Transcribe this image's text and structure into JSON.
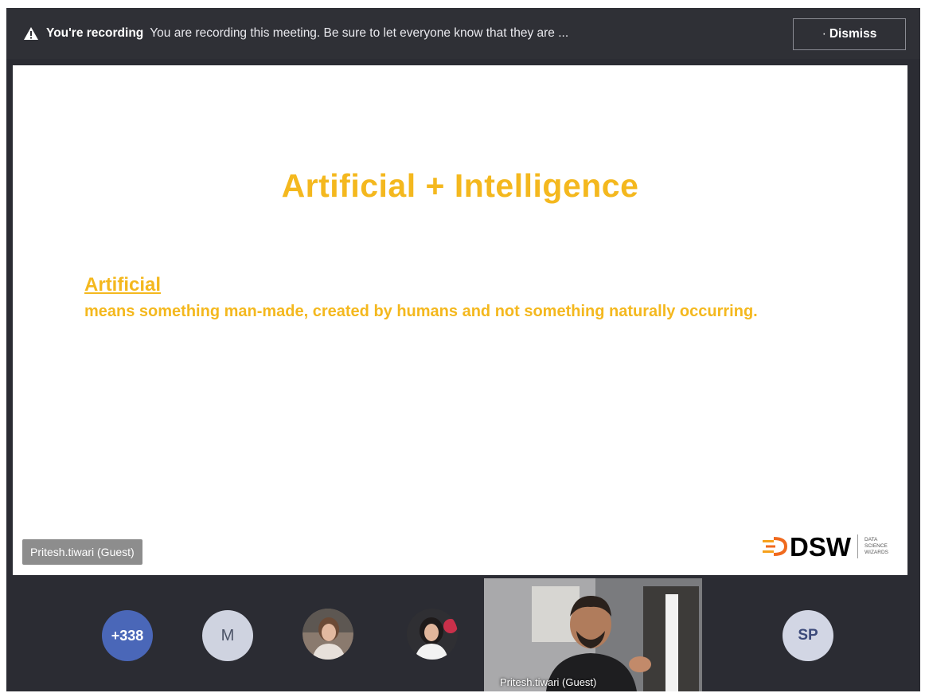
{
  "banner": {
    "title": "You're recording",
    "message": "You are recording this meeting. Be sure to let everyone know that they are ...",
    "dismiss_label": "Dismiss",
    "dismiss_prefix": "·"
  },
  "slide": {
    "title": "Artificial + Intelligence",
    "term": "Artificial",
    "definition": "means something man-made, created by humans and not something naturally occurring.",
    "presenter_tag": "Pritesh.tiwari (Guest)",
    "logo": {
      "mark": "DSW",
      "subtitle_lines": [
        "DATA",
        "SCIENCE",
        "WIZARDS"
      ]
    }
  },
  "participants": {
    "more_count": "+338",
    "initials_1": "M",
    "initials_2": "SP",
    "video_name": "Pritesh.tiwari (Guest)"
  },
  "colors": {
    "accent_yellow": "#f4b81e",
    "frame": "#2b2c33",
    "more_badge": "#4a67b8"
  }
}
